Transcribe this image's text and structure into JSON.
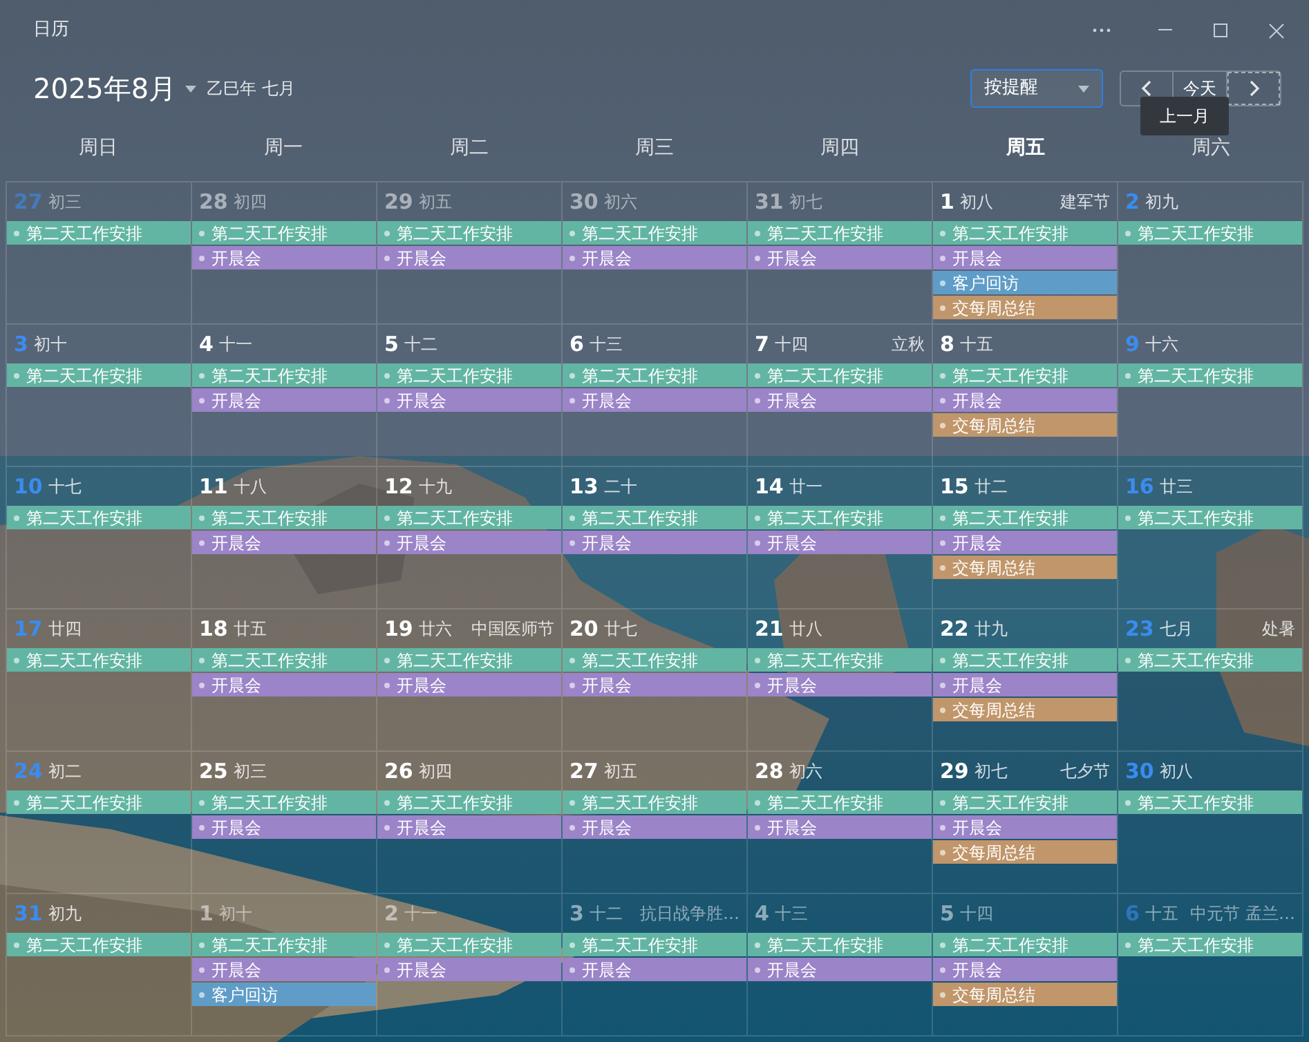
{
  "window": {
    "title": "日历"
  },
  "header": {
    "month": "2025年8月",
    "lunar": "乙巳年 七月",
    "filter": "按提醒",
    "today_button": "今天",
    "tooltip": "上一月"
  },
  "weekdays": [
    {
      "label": "周日",
      "selected": false
    },
    {
      "label": "周一",
      "selected": false
    },
    {
      "label": "周二",
      "selected": false
    },
    {
      "label": "周三",
      "selected": false
    },
    {
      "label": "周四",
      "selected": false
    },
    {
      "label": "周五",
      "selected": true
    },
    {
      "label": "周六",
      "selected": false
    }
  ],
  "weeks": [
    {
      "days": [
        {
          "day": "27",
          "lunar": "初三",
          "in_month": false,
          "events": [
            {
              "title": "第二天工作安排",
              "color": "#63b5a3"
            }
          ]
        },
        {
          "day": "28",
          "lunar": "初四",
          "in_month": false,
          "events": [
            {
              "title": "第二天工作安排",
              "color": "#63b5a3"
            },
            {
              "title": "开晨会",
              "color": "#9b84c8"
            }
          ]
        },
        {
          "day": "29",
          "lunar": "初五",
          "in_month": false,
          "events": [
            {
              "title": "第二天工作安排",
              "color": "#63b5a3"
            },
            {
              "title": "开晨会",
              "color": "#9b84c8"
            }
          ]
        },
        {
          "day": "30",
          "lunar": "初六",
          "in_month": false,
          "events": [
            {
              "title": "第二天工作安排",
              "color": "#63b5a3"
            },
            {
              "title": "开晨会",
              "color": "#9b84c8"
            }
          ]
        },
        {
          "day": "31",
          "lunar": "初七",
          "in_month": false,
          "events": [
            {
              "title": "第二天工作安排",
              "color": "#63b5a3"
            },
            {
              "title": "开晨会",
              "color": "#9b84c8"
            }
          ]
        },
        {
          "day": "1",
          "lunar": "初八",
          "festival": "建军节",
          "in_month": true,
          "events": [
            {
              "title": "第二天工作安排",
              "color": "#63b5a3"
            },
            {
              "title": "开晨会",
              "color": "#9b84c8"
            },
            {
              "title": "客户回访",
              "color": "#5f9dc8"
            },
            {
              "title": "交每周总结",
              "color": "#c0966a"
            }
          ]
        },
        {
          "day": "2",
          "lunar": "初九",
          "in_month": true,
          "events": [
            {
              "title": "第二天工作安排",
              "color": "#63b5a3"
            }
          ]
        }
      ]
    },
    {
      "days": [
        {
          "day": "3",
          "lunar": "初十",
          "in_month": true,
          "events": [
            {
              "title": "第二天工作安排",
              "color": "#63b5a3"
            }
          ]
        },
        {
          "day": "4",
          "lunar": "十一",
          "in_month": true,
          "events": [
            {
              "title": "第二天工作安排",
              "color": "#63b5a3"
            },
            {
              "title": "开晨会",
              "color": "#9b84c8"
            }
          ]
        },
        {
          "day": "5",
          "lunar": "十二",
          "in_month": true,
          "events": [
            {
              "title": "第二天工作安排",
              "color": "#63b5a3"
            },
            {
              "title": "开晨会",
              "color": "#9b84c8"
            }
          ]
        },
        {
          "day": "6",
          "lunar": "十三",
          "in_month": true,
          "events": [
            {
              "title": "第二天工作安排",
              "color": "#63b5a3"
            },
            {
              "title": "开晨会",
              "color": "#9b84c8"
            }
          ]
        },
        {
          "day": "7",
          "lunar": "十四",
          "festival": "立秋",
          "in_month": true,
          "events": [
            {
              "title": "第二天工作安排",
              "color": "#63b5a3"
            },
            {
              "title": "开晨会",
              "color": "#9b84c8"
            }
          ]
        },
        {
          "day": "8",
          "lunar": "十五",
          "in_month": true,
          "events": [
            {
              "title": "第二天工作安排",
              "color": "#63b5a3"
            },
            {
              "title": "开晨会",
              "color": "#9b84c8"
            },
            {
              "title": "交每周总结",
              "color": "#c0966a"
            }
          ]
        },
        {
          "day": "9",
          "lunar": "十六",
          "in_month": true,
          "events": [
            {
              "title": "第二天工作安排",
              "color": "#63b5a3"
            }
          ]
        }
      ]
    },
    {
      "days": [
        {
          "day": "10",
          "lunar": "十七",
          "in_month": true,
          "events": [
            {
              "title": "第二天工作安排",
              "color": "#63b5a3"
            }
          ]
        },
        {
          "day": "11",
          "lunar": "十八",
          "in_month": true,
          "events": [
            {
              "title": "第二天工作安排",
              "color": "#63b5a3"
            },
            {
              "title": "开晨会",
              "color": "#9b84c8"
            }
          ]
        },
        {
          "day": "12",
          "lunar": "十九",
          "in_month": true,
          "events": [
            {
              "title": "第二天工作安排",
              "color": "#63b5a3"
            },
            {
              "title": "开晨会",
              "color": "#9b84c8"
            }
          ]
        },
        {
          "day": "13",
          "lunar": "二十",
          "in_month": true,
          "events": [
            {
              "title": "第二天工作安排",
              "color": "#63b5a3"
            },
            {
              "title": "开晨会",
              "color": "#9b84c8"
            }
          ]
        },
        {
          "day": "14",
          "lunar": "廿一",
          "in_month": true,
          "events": [
            {
              "title": "第二天工作安排",
              "color": "#63b5a3"
            },
            {
              "title": "开晨会",
              "color": "#9b84c8"
            }
          ]
        },
        {
          "day": "15",
          "lunar": "廿二",
          "in_month": true,
          "events": [
            {
              "title": "第二天工作安排",
              "color": "#63b5a3"
            },
            {
              "title": "开晨会",
              "color": "#9b84c8"
            },
            {
              "title": "交每周总结",
              "color": "#c0966a"
            }
          ]
        },
        {
          "day": "16",
          "lunar": "廿三",
          "in_month": true,
          "events": [
            {
              "title": "第二天工作安排",
              "color": "#63b5a3"
            }
          ]
        }
      ]
    },
    {
      "days": [
        {
          "day": "17",
          "lunar": "廿四",
          "in_month": true,
          "events": [
            {
              "title": "第二天工作安排",
              "color": "#63b5a3"
            }
          ]
        },
        {
          "day": "18",
          "lunar": "廿五",
          "in_month": true,
          "events": [
            {
              "title": "第二天工作安排",
              "color": "#63b5a3"
            },
            {
              "title": "开晨会",
              "color": "#9b84c8"
            }
          ]
        },
        {
          "day": "19",
          "lunar": "廿六",
          "festival": "中国医师节",
          "in_month": true,
          "events": [
            {
              "title": "第二天工作安排",
              "color": "#63b5a3"
            },
            {
              "title": "开晨会",
              "color": "#9b84c8"
            }
          ]
        },
        {
          "day": "20",
          "lunar": "廿七",
          "in_month": true,
          "events": [
            {
              "title": "第二天工作安排",
              "color": "#63b5a3"
            },
            {
              "title": "开晨会",
              "color": "#9b84c8"
            }
          ]
        },
        {
          "day": "21",
          "lunar": "廿八",
          "in_month": true,
          "events": [
            {
              "title": "第二天工作安排",
              "color": "#63b5a3"
            },
            {
              "title": "开晨会",
              "color": "#9b84c8"
            }
          ]
        },
        {
          "day": "22",
          "lunar": "廿九",
          "in_month": true,
          "events": [
            {
              "title": "第二天工作安排",
              "color": "#63b5a3"
            },
            {
              "title": "开晨会",
              "color": "#9b84c8"
            },
            {
              "title": "交每周总结",
              "color": "#c0966a"
            }
          ]
        },
        {
          "day": "23",
          "lunar": "七月",
          "festival": "处暑",
          "in_month": true,
          "events": [
            {
              "title": "第二天工作安排",
              "color": "#63b5a3"
            }
          ]
        }
      ]
    },
    {
      "days": [
        {
          "day": "24",
          "lunar": "初二",
          "in_month": true,
          "events": [
            {
              "title": "第二天工作安排",
              "color": "#63b5a3"
            }
          ]
        },
        {
          "day": "25",
          "lunar": "初三",
          "in_month": true,
          "events": [
            {
              "title": "第二天工作安排",
              "color": "#63b5a3"
            },
            {
              "title": "开晨会",
              "color": "#9b84c8"
            }
          ]
        },
        {
          "day": "26",
          "lunar": "初四",
          "in_month": true,
          "events": [
            {
              "title": "第二天工作安排",
              "color": "#63b5a3"
            },
            {
              "title": "开晨会",
              "color": "#9b84c8"
            }
          ]
        },
        {
          "day": "27",
          "lunar": "初五",
          "in_month": true,
          "events": [
            {
              "title": "第二天工作安排",
              "color": "#63b5a3"
            },
            {
              "title": "开晨会",
              "color": "#9b84c8"
            }
          ]
        },
        {
          "day": "28",
          "lunar": "初六",
          "in_month": true,
          "events": [
            {
              "title": "第二天工作安排",
              "color": "#63b5a3"
            },
            {
              "title": "开晨会",
              "color": "#9b84c8"
            }
          ]
        },
        {
          "day": "29",
          "lunar": "初七",
          "festival": "七夕节",
          "in_month": true,
          "events": [
            {
              "title": "第二天工作安排",
              "color": "#63b5a3"
            },
            {
              "title": "开晨会",
              "color": "#9b84c8"
            },
            {
              "title": "交每周总结",
              "color": "#c0966a"
            }
          ]
        },
        {
          "day": "30",
          "lunar": "初八",
          "in_month": true,
          "events": [
            {
              "title": "第二天工作安排",
              "color": "#63b5a3"
            }
          ]
        }
      ]
    },
    {
      "days": [
        {
          "day": "31",
          "lunar": "初九",
          "in_month": true,
          "events": [
            {
              "title": "第二天工作安排",
              "color": "#63b5a3"
            }
          ]
        },
        {
          "day": "1",
          "lunar": "初十",
          "in_month": false,
          "events": [
            {
              "title": "第二天工作安排",
              "color": "#63b5a3"
            },
            {
              "title": "开晨会",
              "color": "#9b84c8"
            },
            {
              "title": "客户回访",
              "color": "#5f9dc8"
            }
          ]
        },
        {
          "day": "2",
          "lunar": "十一",
          "in_month": false,
          "events": [
            {
              "title": "第二天工作安排",
              "color": "#63b5a3"
            },
            {
              "title": "开晨会",
              "color": "#9b84c8"
            }
          ]
        },
        {
          "day": "3",
          "lunar": "十二",
          "festival": "抗日战争胜…",
          "in_month": false,
          "events": [
            {
              "title": "第二天工作安排",
              "color": "#63b5a3"
            },
            {
              "title": "开晨会",
              "color": "#9b84c8"
            }
          ]
        },
        {
          "day": "4",
          "lunar": "十三",
          "in_month": false,
          "events": [
            {
              "title": "第二天工作安排",
              "color": "#63b5a3"
            },
            {
              "title": "开晨会",
              "color": "#9b84c8"
            }
          ]
        },
        {
          "day": "5",
          "lunar": "十四",
          "in_month": false,
          "events": [
            {
              "title": "第二天工作安排",
              "color": "#63b5a3"
            },
            {
              "title": "开晨会",
              "color": "#9b84c8"
            },
            {
              "title": "交每周总结",
              "color": "#c0966a"
            }
          ]
        },
        {
          "day": "6",
          "lunar": "十五",
          "festival": "中元节 孟兰…",
          "in_month": false,
          "events": [
            {
              "title": "第二天工作安排",
              "color": "#63b5a3"
            }
          ]
        }
      ]
    }
  ]
}
